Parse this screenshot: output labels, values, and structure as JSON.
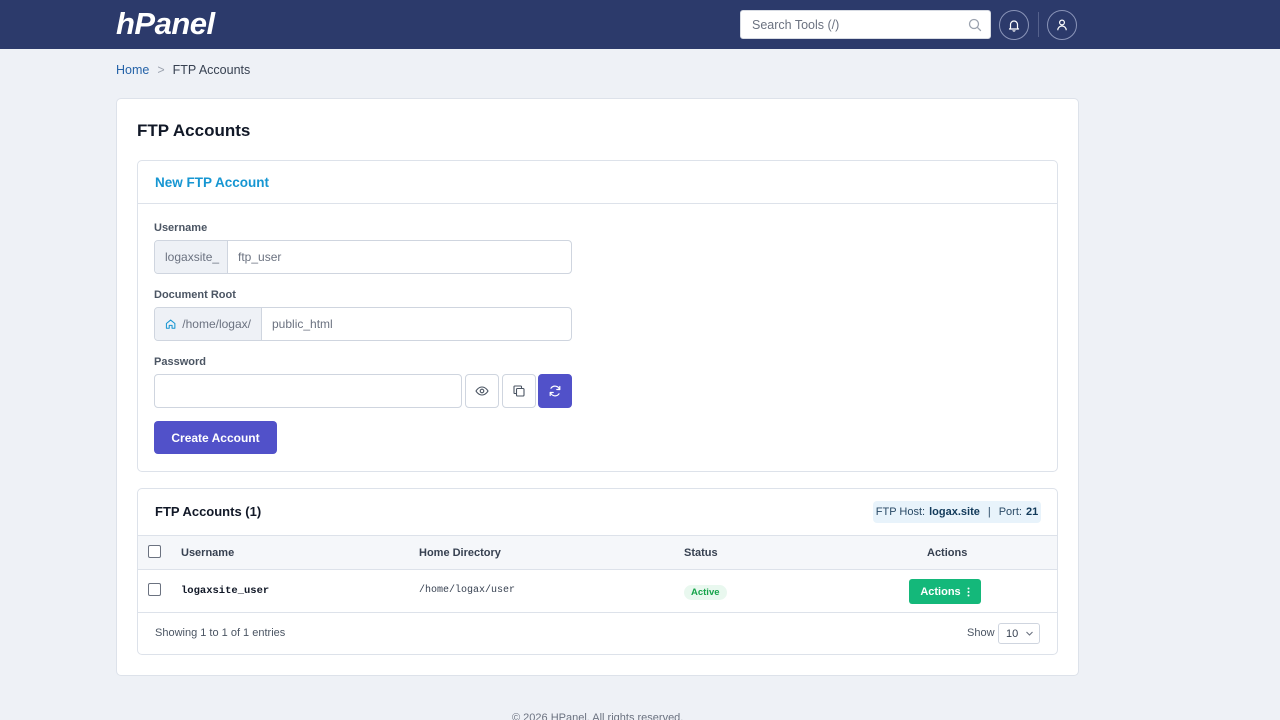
{
  "app": {
    "logo": "hPanel"
  },
  "header": {
    "search_placeholder": "Search Tools (/)"
  },
  "breadcrumb": {
    "home": "Home",
    "separator": ">",
    "current": "FTP Accounts"
  },
  "page_title": "FTP Accounts",
  "new_account": {
    "title": "New FTP Account",
    "username_label": "Username",
    "username_prefix": "logaxsite_",
    "username_placeholder": "ftp_user",
    "docroot_label": "Document Root",
    "docroot_prefix": "/home/logax/",
    "docroot_placeholder": "public_html",
    "password_label": "Password",
    "password_value": "",
    "create_label": "Create Account"
  },
  "accounts": {
    "title": "FTP Accounts (1)",
    "host_label": "FTP Host:",
    "host_value": "logax.site",
    "port_label": "Port:",
    "port_value": "21",
    "columns": {
      "username": "Username",
      "home": "Home Directory",
      "status": "Status",
      "actions": "Actions"
    },
    "rows": [
      {
        "username": "logaxsite_user",
        "home": "/home/logax/user",
        "status": "Active",
        "actions_label": "Actions"
      }
    ],
    "showing": "Showing 1 to 1 of 1 entries",
    "show_label": "Show",
    "page_size": "10"
  },
  "footer": "© 2026 HPanel. All rights reserved.",
  "colors": {
    "header_bg": "#2c3a6b",
    "primary": "#5151c9",
    "accent_title": "#1696d2",
    "success": "#14b87a"
  }
}
